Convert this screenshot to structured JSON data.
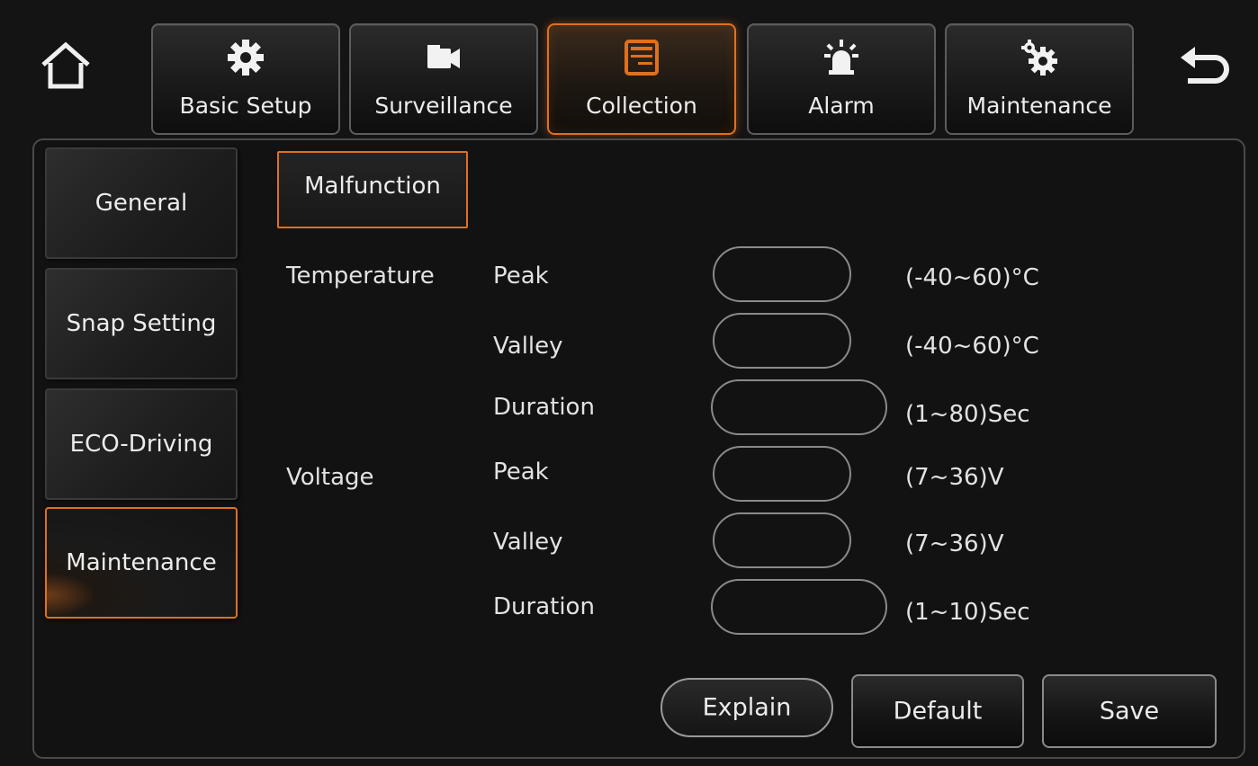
{
  "top_nav": {
    "home_icon": "home-icon",
    "back_icon": "back-arrow-icon",
    "tabs": [
      {
        "label": "Basic Setup",
        "icon": "gear-icon"
      },
      {
        "label": "Surveillance",
        "icon": "camera-icon"
      },
      {
        "label": "Collection",
        "icon": "document-icon",
        "active": true
      },
      {
        "label": "Alarm",
        "icon": "alarm-light-icon"
      },
      {
        "label": "Maintenance",
        "icon": "gears-icon"
      }
    ]
  },
  "sidebar": {
    "items": [
      {
        "label": "General"
      },
      {
        "label": "Snap Setting"
      },
      {
        "label": "ECO-Driving"
      },
      {
        "label": "Maintenance",
        "active": true
      }
    ]
  },
  "sub_tab": {
    "label": "Malfunction"
  },
  "form": {
    "temperature": {
      "group_label": "Temperature",
      "peak": {
        "label": "Peak",
        "value": "",
        "range": "(-40~60)°C"
      },
      "valley": {
        "label": "Valley",
        "value": "",
        "range": "(-40~60)°C"
      },
      "duration": {
        "label": "Duration",
        "value": "",
        "range": "(1~80)Sec"
      }
    },
    "voltage": {
      "group_label": "Voltage",
      "peak": {
        "label": "Peak",
        "value": "",
        "range": "(7~36)V"
      },
      "valley": {
        "label": "Valley",
        "value": "",
        "range": "(7~36)V"
      },
      "duration": {
        "label": "Duration",
        "value": "",
        "range": "(1~10)Sec"
      }
    }
  },
  "actions": {
    "explain_label": "Explain",
    "default_label": "Default",
    "save_label": "Save"
  },
  "colors": {
    "accent": "#e0701e",
    "background": "#141414",
    "border": "#8a8a8a"
  }
}
